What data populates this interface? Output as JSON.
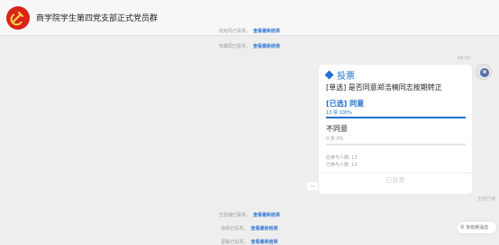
{
  "header": {
    "title": "商学院学生第四党支部正式党员群"
  },
  "system_top": [
    {
      "text": "张旭丹已投票，",
      "link": "查看最新结果"
    },
    {
      "text": "宋鑫阳已投票，",
      "link": "查看最新结果"
    }
  ],
  "message": {
    "time": "09:03",
    "read_status": "全部已读"
  },
  "poll": {
    "heading": "投票",
    "question": "[单选] 是否同意郑浩楠同志按期转正",
    "options": [
      {
        "label": "[已选] 同意",
        "stat": "13 票  100%",
        "percent": 100
      },
      {
        "label": "不同意",
        "stat": "0 票  0%",
        "percent": 0
      }
    ],
    "should_count": "应参与人数: 13",
    "participated_count": "已参与人数: 13",
    "button": "已投票"
  },
  "more_label": "…",
  "system_bottom": [
    {
      "text": "王盈瑞已投票，",
      "link": "查看最新结果"
    },
    {
      "text": "余帆已投票，",
      "link": "查看最新结果"
    },
    {
      "text": "邵毅已投票，",
      "link": "查看最新结果"
    }
  ],
  "new_message": "你有新消息",
  "colors": {
    "accent": "#1f6fd1",
    "avatar_red": "#d8241b"
  },
  "icons": [
    "party-emblem-icon",
    "poll-diamond-icon",
    "location-pin-icon"
  ]
}
